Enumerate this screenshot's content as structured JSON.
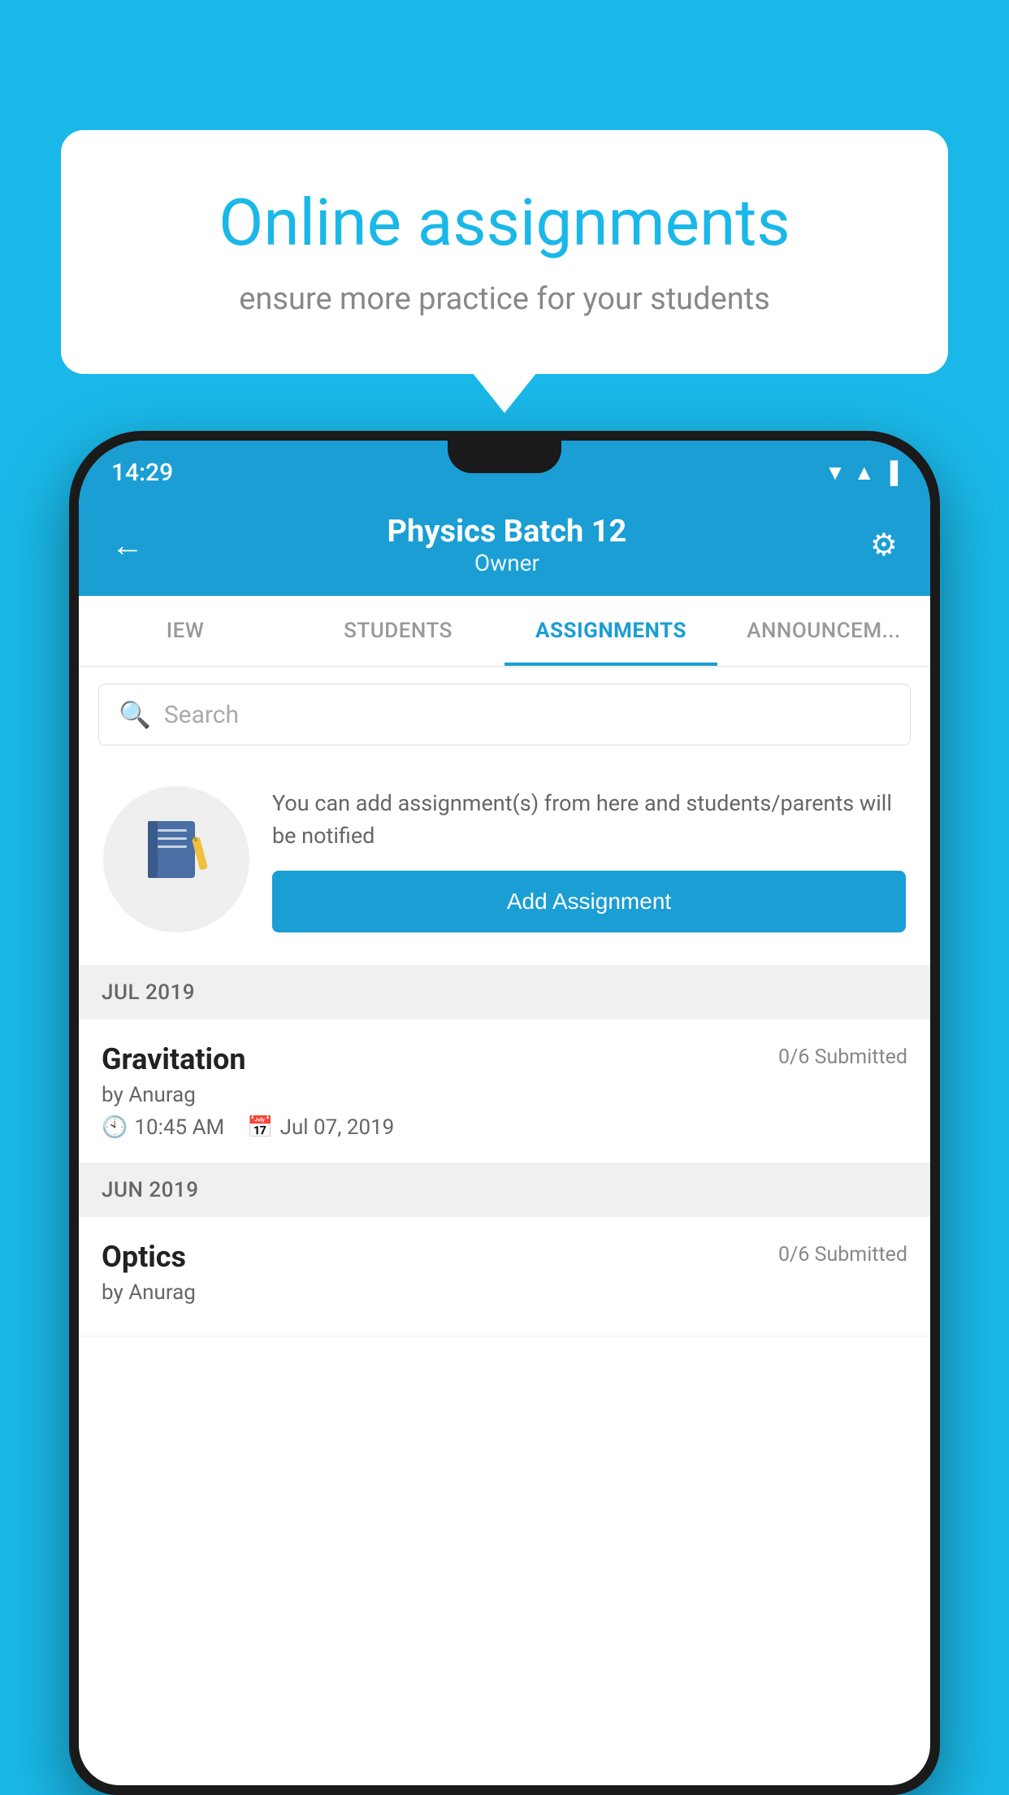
{
  "background_color": "#1ab8e8",
  "speech_bubble": {
    "title": "Online assignments",
    "subtitle": "ensure more practice for your students"
  },
  "status_bar": {
    "time": "14:29",
    "wifi_icon": "▼",
    "signal_icon": "▲",
    "battery_icon": "▐"
  },
  "header": {
    "title": "Physics Batch 12",
    "subtitle": "Owner",
    "back_label": "←",
    "settings_label": "⚙"
  },
  "tabs": [
    {
      "label": "IEW",
      "active": false
    },
    {
      "label": "STUDENTS",
      "active": false
    },
    {
      "label": "ASSIGNMENTS",
      "active": true
    },
    {
      "label": "ANNOUNCEM...",
      "active": false
    }
  ],
  "search": {
    "placeholder": "Search"
  },
  "promo": {
    "icon": "📓",
    "text": "You can add assignment(s) from here and students/parents will be notified",
    "button_label": "Add Assignment"
  },
  "sections": [
    {
      "label": "JUL 2019",
      "assignments": [
        {
          "title": "Gravitation",
          "submitted": "0/6 Submitted",
          "author": "by Anurag",
          "time": "10:45 AM",
          "date": "Jul 07, 2019"
        }
      ]
    },
    {
      "label": "JUN 2019",
      "assignments": [
        {
          "title": "Optics",
          "submitted": "0/6 Submitted",
          "author": "by Anurag",
          "time": "",
          "date": ""
        }
      ]
    }
  ]
}
